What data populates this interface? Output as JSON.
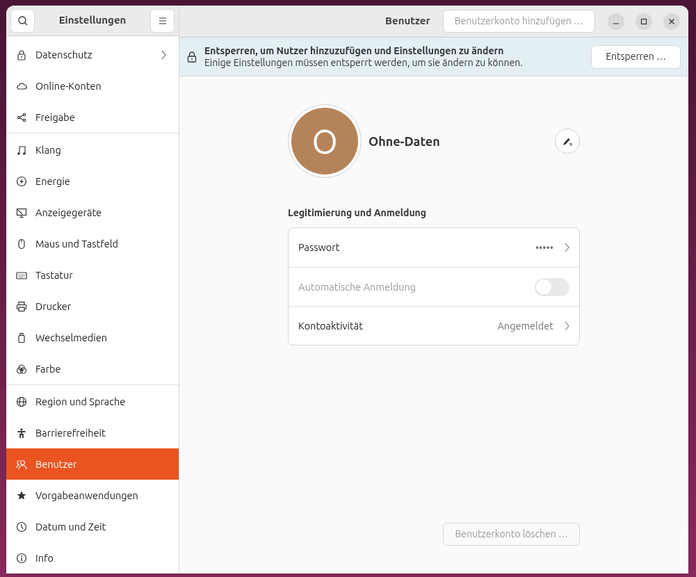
{
  "window": {
    "title": "Einstellungen"
  },
  "header": {
    "title": "Benutzer",
    "add_button": {
      "label": "Benutzerkonto hinzufügen …",
      "disabled": true
    }
  },
  "sidebar": {
    "groups": [
      {
        "items": [
          {
            "label": "Datenschutz",
            "selected": false,
            "submenu": true
          },
          {
            "label": "Online-Konten",
            "selected": false,
            "submenu": false
          },
          {
            "label": "Freigabe",
            "selected": false,
            "submenu": false
          }
        ]
      },
      {
        "items": [
          {
            "label": "Klang",
            "selected": false,
            "submenu": false
          },
          {
            "label": "Energie",
            "selected": false,
            "submenu": false
          },
          {
            "label": "Anzeigegeräte",
            "selected": false,
            "submenu": false
          },
          {
            "label": "Maus und Tastfeld",
            "selected": false,
            "submenu": false
          },
          {
            "label": "Tastatur",
            "selected": false,
            "submenu": false
          },
          {
            "label": "Drucker",
            "selected": false,
            "submenu": false
          },
          {
            "label": "Wechselmedien",
            "selected": false,
            "submenu": false
          },
          {
            "label": "Farbe",
            "selected": false,
            "submenu": false
          }
        ]
      },
      {
        "items": [
          {
            "label": "Region und Sprache",
            "selected": false,
            "submenu": false
          },
          {
            "label": "Barrierefreiheit",
            "selected": false,
            "submenu": false
          },
          {
            "label": "Benutzer",
            "selected": true,
            "submenu": false
          },
          {
            "label": "Vorgabeanwendungen",
            "selected": false,
            "submenu": false
          },
          {
            "label": "Datum und Zeit",
            "selected": false,
            "submenu": false
          },
          {
            "label": "Info",
            "selected": false,
            "submenu": false
          }
        ]
      }
    ]
  },
  "banner": {
    "title": "Entsperren, um Nutzer hinzuzufügen und Einstellungen zu ändern",
    "subtitle": "Einige Einstellungen müssen entsperrt werden, um sie ändern zu können.",
    "button": "Entsperren …"
  },
  "user": {
    "initial": "O",
    "name": "Ohne-Daten"
  },
  "section": {
    "title": "Legitimierung und Anmeldung",
    "rows": [
      {
        "kind": "value",
        "label": "Passwort",
        "value": "•••••",
        "disabled": false
      },
      {
        "kind": "switch",
        "label": "Automatische Anmeldung",
        "on": false,
        "disabled": true
      },
      {
        "kind": "value",
        "label": "Kontoaktivität",
        "value": "Angemeldet",
        "disabled": false
      }
    ]
  },
  "delete_button": {
    "label": "Benutzerkonto löschen …",
    "disabled": true
  }
}
